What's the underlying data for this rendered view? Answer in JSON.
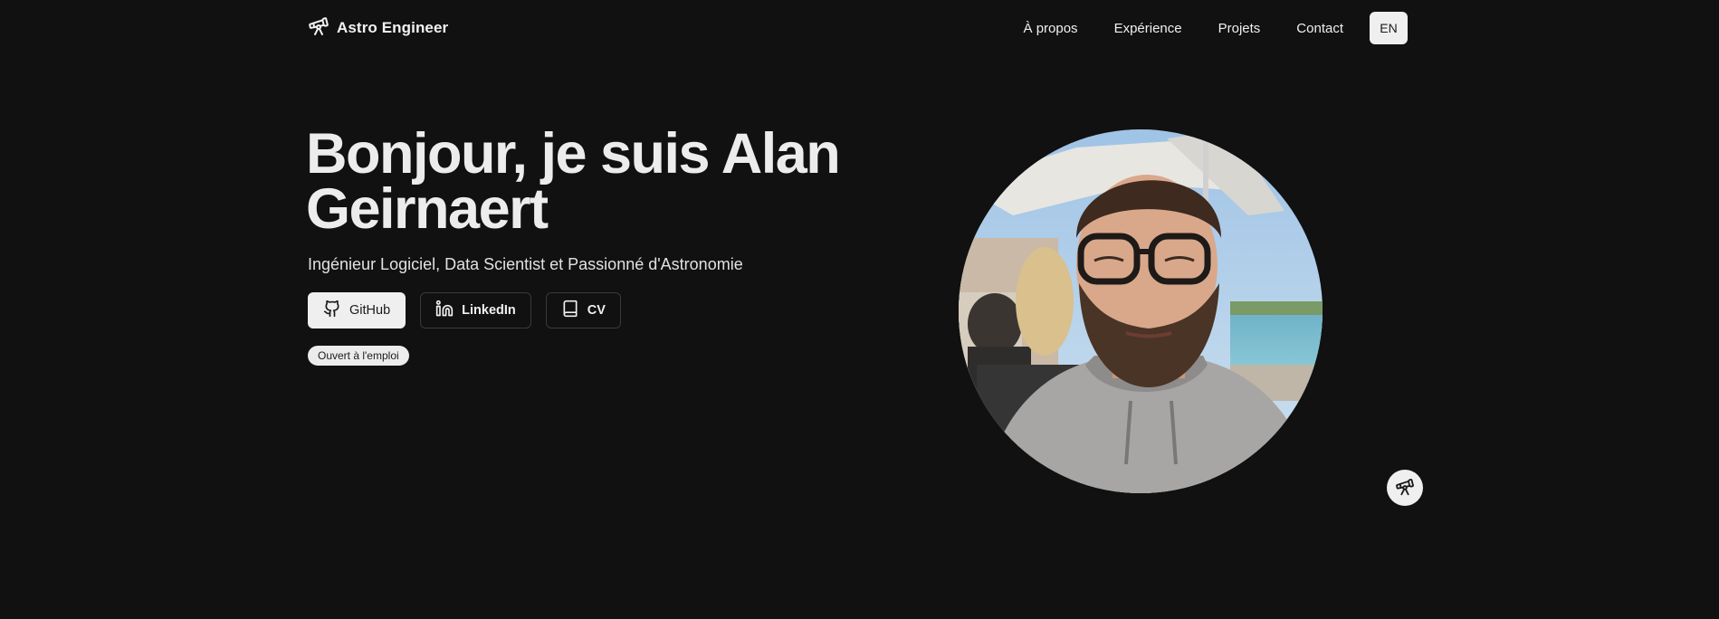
{
  "header": {
    "brand": {
      "name": "Astro Engineer",
      "icon": "telescope-icon"
    },
    "nav": [
      {
        "label": "À propos"
      },
      {
        "label": "Expérience"
      },
      {
        "label": "Projets"
      },
      {
        "label": "Contact"
      }
    ],
    "language_button": "EN"
  },
  "hero": {
    "title": "Bonjour, je suis Alan Geirnaert",
    "subtitle": "Ingénieur Logiciel, Data Scientist et Passionné d'Astronomie",
    "buttons": [
      {
        "label": "GitHub",
        "icon": "github-icon"
      },
      {
        "label": "LinkedIn",
        "icon": "linkedin-icon"
      },
      {
        "label": "CV",
        "icon": "book-icon"
      }
    ],
    "badge": "Ouvert à l'emploi"
  },
  "photo": {
    "shape": "circle"
  },
  "floating_button": {
    "icon": "telescope-icon"
  },
  "colors": {
    "background": "#111111",
    "text": "#ececec",
    "button_light": "#efefef",
    "button_border": "#3a3a3a"
  }
}
